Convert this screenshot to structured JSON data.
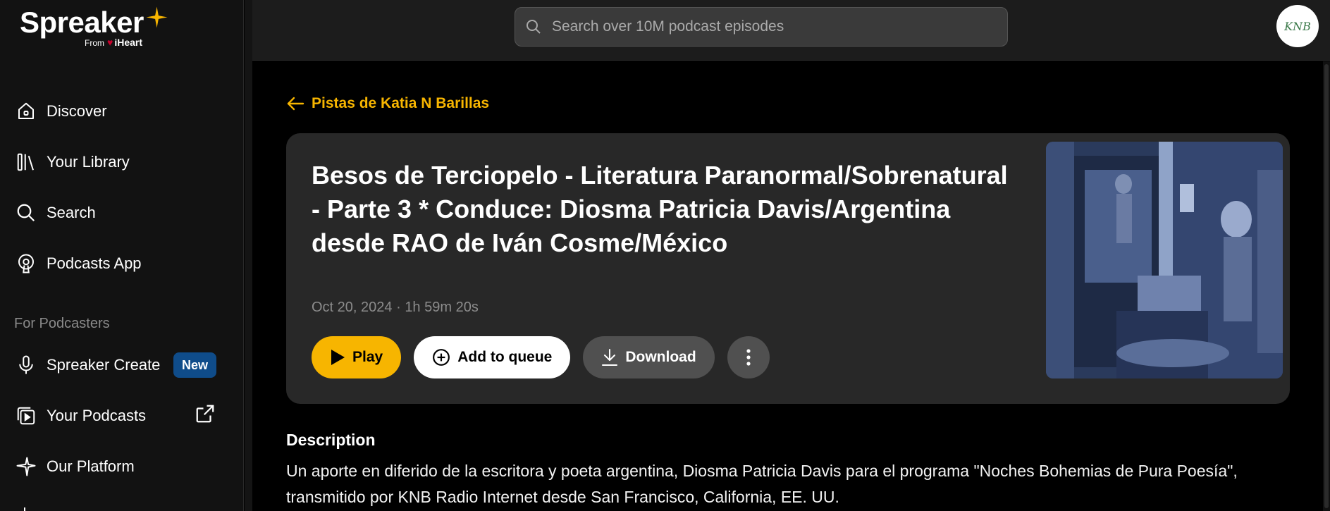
{
  "brand": {
    "name": "Spreaker",
    "from_label": "From",
    "partner": "iHeart"
  },
  "sidebar": {
    "items": [
      {
        "label": "Discover",
        "icon": "home-icon"
      },
      {
        "label": "Your Library",
        "icon": "library-icon"
      },
      {
        "label": "Search",
        "icon": "search-icon"
      },
      {
        "label": "Podcasts App",
        "icon": "podcast-app-icon"
      }
    ],
    "section_title": "For Podcasters",
    "podcaster_items": [
      {
        "label": "Spreaker Create",
        "icon": "microphone-icon",
        "badge": "New"
      },
      {
        "label": "Your Podcasts",
        "icon": "podcasts-icon",
        "trailing_icon": "external-link-icon"
      },
      {
        "label": "Our Platform",
        "icon": "star-icon"
      }
    ]
  },
  "search": {
    "placeholder": "Search over 10M podcast episodes"
  },
  "user": {
    "avatar_text": "KNB"
  },
  "episode": {
    "back_label": "Pistas de Katia N Barillas",
    "title": "Besos de Terciopelo - Literatura Paranormal/Sobrenatural - Parte 3 * Conduce: Diosma Patricia Davis/Argentina desde RAO de Iván Cosme/México",
    "date": "Oct 20, 2024",
    "duration": "1h 59m 20s",
    "meta_separator": " · ",
    "actions": {
      "play": "Play",
      "queue": "Add to queue",
      "download": "Download"
    },
    "description_heading": "Description",
    "description": "Un aporte en diferido de la escritora y poeta argentina, Diosma Patricia Davis para el programa \"Noches Bohemias de Pura Poesía\", transmitido por KNB Radio Internet desde San Francisco, California, EE. UU."
  },
  "colors": {
    "accent": "#f7b500",
    "badge": "#0f4c8a",
    "card": "#282828",
    "sidebar": "#121212"
  }
}
